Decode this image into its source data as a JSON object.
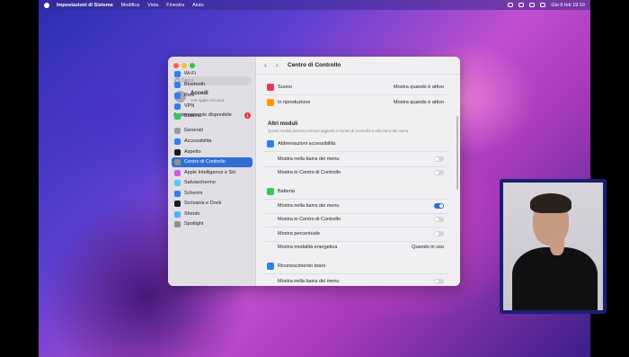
{
  "menubar": {
    "app": "Impostazioni di Sistema",
    "menus": [
      "Modifica",
      "Vista",
      "Finestra",
      "Aiuto"
    ],
    "datetime": "Gio 6 feb  19:19"
  },
  "sidebar": {
    "search_placeholder": "Cerca",
    "account": {
      "title": "Accedi",
      "subtitle": "con Apple Account"
    },
    "update": {
      "label": "Aggiornamento disponibile",
      "badge": "1"
    },
    "items": [
      {
        "label": "Wi-Fi",
        "color": "#2f7ef0"
      },
      {
        "label": "Bluetooth",
        "color": "#2f7ef0"
      },
      {
        "label": "Rete",
        "color": "#2f7ef0"
      },
      {
        "label": "VPN",
        "color": "#2f7ef0"
      },
      {
        "label": "Batteria",
        "color": "#35c759"
      },
      {
        "label": "Generali",
        "color": "#9a9aa0"
      },
      {
        "label": "Accessibilità",
        "color": "#2f7ef0"
      },
      {
        "label": "Aspetto",
        "color": "#1c1c1e"
      },
      {
        "label": "Centro di Controllo",
        "color": "#8e8e93"
      },
      {
        "label": "Apple Intelligence e Siri",
        "color": "#d05ce0"
      },
      {
        "label": "Salvaschermo",
        "color": "#5ac8fa"
      },
      {
        "label": "Schermi",
        "color": "#2f7ef0"
      },
      {
        "label": "Scrivania e Dock",
        "color": "#1c1c1e"
      },
      {
        "label": "Sfondo",
        "color": "#4cb0f5"
      },
      {
        "label": "Spotlight",
        "color": "#8e8e93"
      }
    ]
  },
  "main": {
    "title": "Centro di Controllo",
    "rows_top": [
      {
        "label": "Suono",
        "value": "Mostra quando è attivo",
        "color": "#e6375a"
      },
      {
        "label": "In riproduzione",
        "value": "Mostra quando è attivo",
        "color": "#ff9500"
      }
    ],
    "section": {
      "title": "Altri moduli",
      "desc": "Questi moduli possono essere aggiunti a Centro di Controllo e alla barra dei menu."
    },
    "accessibility": {
      "title": "Abbreviazioni accessibilità",
      "color": "#2f7ef0",
      "opt1": "Mostra nella barra dei menu",
      "opt2": "Mostra in Centro di Controllo"
    },
    "battery": {
      "title": "Batteria",
      "color": "#35c759",
      "opt1": "Mostra nella barra dei menu",
      "opt2": "Mostra in Centro di Controllo",
      "opt3": "Mostra percentuale",
      "opt4": "Mostra modalità energetica",
      "opt4_value": "Quando in uso"
    },
    "music": {
      "title": "Riconoscimento brani",
      "color": "#2f7ef0",
      "opt1": "Mostra nella barra dei menu"
    }
  },
  "colors": {
    "accent": "#2f6fd6",
    "badge": "#e5393b"
  }
}
